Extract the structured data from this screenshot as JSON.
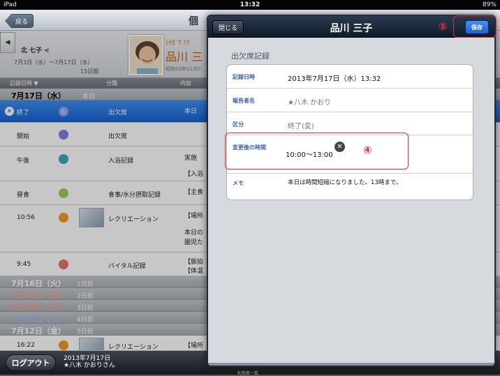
{
  "status": {
    "device": "iPad",
    "time": "13:32",
    "battery": "89%"
  },
  "topbar": {
    "back": "戻る",
    "title": "個"
  },
  "patient": {
    "name": "北 七子 <",
    "range": "7月3日（水）〜7月17日（水）",
    "days": "15日間",
    "kana": "ｼﾅｶﾞﾜ ﾐﾂ",
    "bigname": "品川 三",
    "birth": "昭和03年11月0"
  },
  "columns": {
    "date": "記録日時 ▼",
    "category": "分類",
    "content": "内容"
  },
  "today": {
    "date": "7月17日（水）",
    "label": "本日"
  },
  "rows": [
    {
      "time": "終了",
      "cat": "出欠席",
      "content": "本日"
    },
    {
      "time": "開始",
      "cat": "出欠席",
      "content": ""
    },
    {
      "time": "午後",
      "cat": "入浴記録",
      "content": "実施",
      "content2": "【入浴"
    },
    {
      "time": "昼食",
      "cat": "食事/水分摂取記録",
      "content": "【主食"
    },
    {
      "time": "10:56",
      "cat": "レクリエーション",
      "content": "【場所",
      "content2": "本日の",
      "content3": "園児た"
    },
    {
      "time": "9:45",
      "cat": "バイタル記録",
      "content": "【脈拍",
      "content2": "【体温"
    }
  ],
  "days": [
    {
      "date": "7月16日（火）",
      "ago": "1日前"
    },
    {
      "date": "7月15日（月）",
      "ago": "2日前"
    },
    {
      "date": "7月14日（日）",
      "ago": "3日前"
    },
    {
      "date": "7月13日（土）",
      "ago": "4日前"
    },
    {
      "date": "7月12日（金）",
      "ago": "5日前"
    }
  ],
  "lastrow": {
    "time": "16:22",
    "cat": "レクリエーション",
    "content": "【場所"
  },
  "bottom": {
    "logout": "ログアウト",
    "date": "2013年7月17日",
    "user": "★八木 かおりさん",
    "tab": "利用者一覧"
  },
  "modal": {
    "close": "閉じる",
    "title": "品川 三子",
    "save": "保存",
    "section": "出欠席記録",
    "fields": [
      {
        "label": "記録日時",
        "value": "2013年7月17日（水）13:32"
      },
      {
        "label": "報告者名",
        "value": "★八木 かおり"
      },
      {
        "label": "区分",
        "value": "終了(変)"
      },
      {
        "label": "変更後の時間",
        "value": "10:00〜13:00"
      },
      {
        "label": "メモ",
        "value": "本日は時間短縮になりました。13時まで。"
      }
    ],
    "marker4": "④",
    "marker5": "⑤"
  },
  "colors": {
    "accent": "#1a6fe0",
    "highlight": "#e03030",
    "name": "#d35400"
  }
}
